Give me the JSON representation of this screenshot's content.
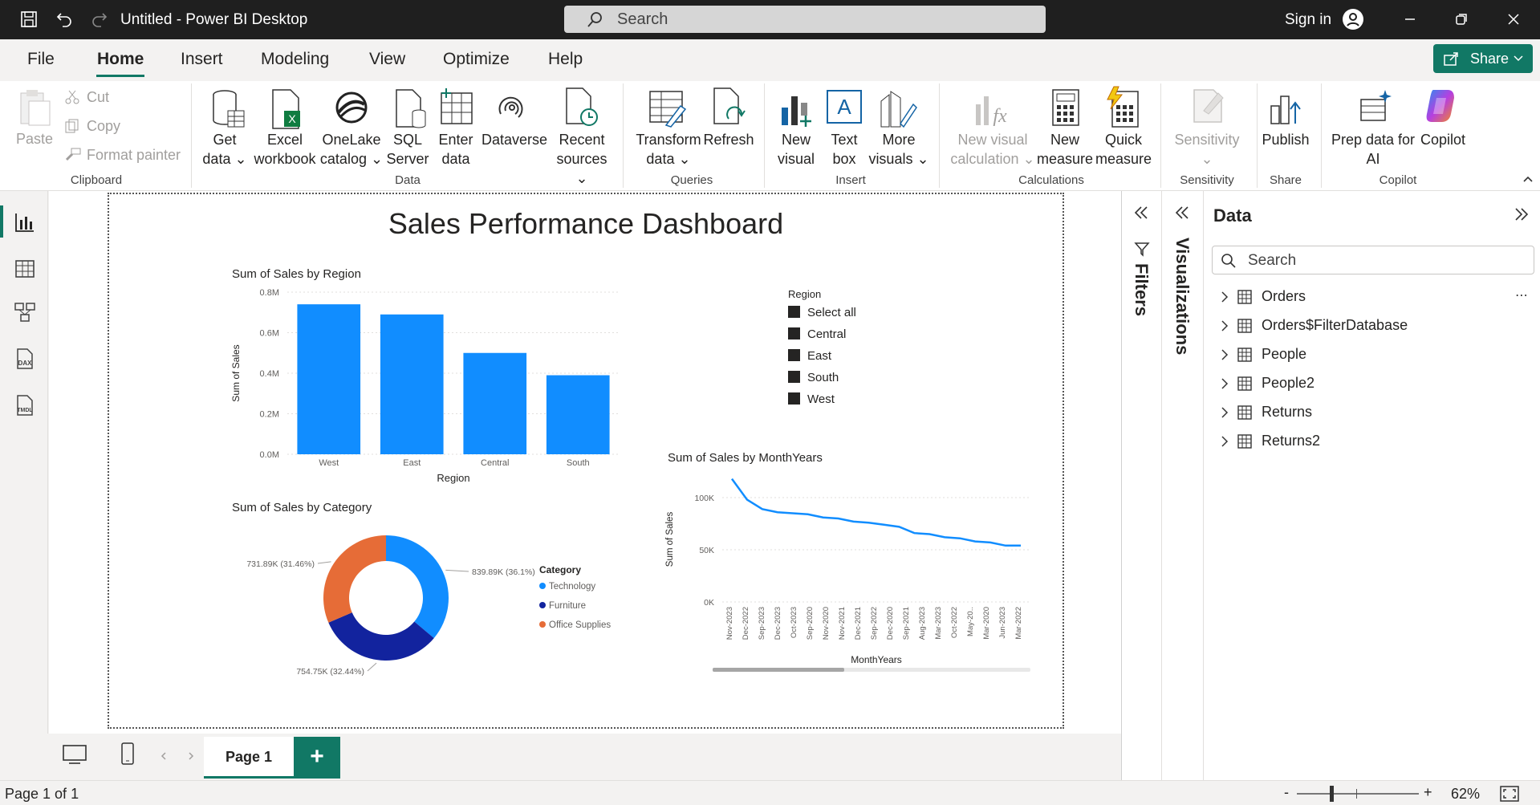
{
  "titlebar": {
    "title": "Untitled - Power BI Desktop",
    "search": "Search",
    "signin": "Sign in"
  },
  "menu": {
    "file": "File",
    "home": "Home",
    "insert": "Insert",
    "modeling": "Modeling",
    "view": "View",
    "optimize": "Optimize",
    "help": "Help",
    "share": "Share"
  },
  "ribbon": {
    "clipboard": {
      "paste": "Paste",
      "cut": "Cut",
      "copy": "Copy",
      "format_painter": "Format painter",
      "group": "Clipboard"
    },
    "data": {
      "get_data_1": "Get",
      "get_data_2": "data",
      "excel_1": "Excel",
      "excel_2": "workbook",
      "onelake_1": "OneLake",
      "onelake_2": "catalog",
      "sql_1": "SQL",
      "sql_2": "Server",
      "enter_1": "Enter",
      "enter_2": "data",
      "dataverse": "Dataverse",
      "recent_1": "Recent",
      "recent_2": "sources",
      "group": "Data"
    },
    "queries": {
      "transform_1": "Transform",
      "transform_2": "data",
      "refresh": "Refresh",
      "group": "Queries"
    },
    "insert": {
      "newvisual_1": "New",
      "newvisual_2": "visual",
      "textbox_1": "Text",
      "textbox_2": "box",
      "more_1": "More",
      "more_2": "visuals",
      "group": "Insert"
    },
    "calc": {
      "nvc_1": "New visual",
      "nvc_2": "calculation",
      "nm_1": "New",
      "nm_2": "measure",
      "qm_1": "Quick",
      "qm_2": "measure",
      "group": "Calculations"
    },
    "sensitivity": {
      "label": "Sensitivity",
      "group": "Sensitivity"
    },
    "share": {
      "publish": "Publish",
      "group": "Share"
    },
    "copilot": {
      "prep_1": "Prep data for",
      "prep_2": "AI",
      "copilot": "Copilot",
      "group": "Copilot"
    }
  },
  "report": {
    "title": "Sales Performance Dashboard",
    "bar_title": "Sum of Sales by Region",
    "donut_title": "Sum of Sales by Category",
    "line_title": "Sum of Sales by MonthYears",
    "slicer": {
      "title": "Region",
      "items": [
        "Select all",
        "Central",
        "East",
        "South",
        "West"
      ]
    }
  },
  "colors": {
    "bar": "#118dff",
    "furniture": "#12239e",
    "office": "#e66c37",
    "tech": "#118dff",
    "accent": "#117865"
  },
  "chart_data": [
    {
      "type": "bar",
      "title": "Sum of Sales by Region",
      "xlabel": "Region",
      "ylabel": "Sum of Sales",
      "categories": [
        "West",
        "East",
        "Central",
        "South"
      ],
      "values": [
        0.74,
        0.69,
        0.5,
        0.39
      ],
      "yticks": [
        "0.0M",
        "0.2M",
        "0.4M",
        "0.6M",
        "0.8M"
      ],
      "ylim": [
        0,
        0.8
      ]
    },
    {
      "type": "pie",
      "title": "Sum of Sales by Category",
      "legend_title": "Category",
      "categories": [
        "Technology",
        "Furniture",
        "Office Supplies"
      ],
      "values": [
        36.1,
        32.44,
        31.46
      ],
      "labels": [
        "839.89K (36.1%)",
        "754.75K (32.44%)",
        "731.89K (31.46%)"
      ]
    },
    {
      "type": "line",
      "title": "Sum of Sales by MonthYears",
      "xlabel": "MonthYears",
      "ylabel": "Sum of Sales",
      "x": [
        "Nov-2023",
        "Dec-2022",
        "Sep-2023",
        "Dec-2023",
        "Oct-2023",
        "Sep-2020",
        "Nov-2020",
        "Nov-2021",
        "Dec-2021",
        "Sep-2022",
        "Dec-2020",
        "Sep-2021",
        "Aug-2023",
        "Mar-2023",
        "Oct-2022",
        "May-20..",
        "Mar-2020",
        "Jun-2023",
        "Mar-2022"
      ],
      "values": [
        118,
        98,
        89,
        86,
        85,
        84,
        81,
        80,
        77,
        76,
        74,
        72,
        66,
        65,
        62,
        61,
        58,
        57,
        54,
        54
      ],
      "yticks": [
        "0K",
        "50K",
        "100K"
      ],
      "ylim": [
        0,
        120
      ]
    }
  ],
  "data_pane": {
    "title": "Data",
    "search": "Search",
    "tables": [
      "Orders",
      "Orders$FilterDatabase",
      "People",
      "People2",
      "Returns",
      "Returns2"
    ]
  },
  "panes": {
    "filters": "Filters",
    "visualizations": "Visualizations"
  },
  "tabs": {
    "page1": "Page 1",
    "add": "+"
  },
  "status": {
    "page": "Page 1 of 1",
    "zoom": "62%",
    "minus": "-",
    "plus": "+"
  }
}
